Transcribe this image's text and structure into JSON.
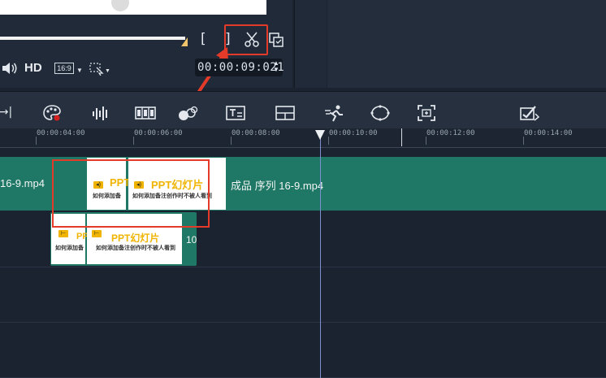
{
  "preview": {
    "hd_label": "HD",
    "aspect_ratio": "16:9",
    "timecode": "00:00:09:021",
    "mark_in": "[",
    "mark_out": "]"
  },
  "toolbar": {
    "icons": [
      "insert-arrow-icon",
      "color-palette-icon",
      "audio-wave-icon",
      "storyboard-icon",
      "motion-path-icon",
      "title-icon",
      "split-screen-icon",
      "motion-tracking-icon",
      "mask-icon",
      "crop-capture-icon",
      "auto-edit-icon"
    ]
  },
  "ruler": {
    "labels": [
      "00:00:04:00",
      "00:00:06:00",
      "00:00:08:00",
      "00:00:10:00",
      "00:00:12:00",
      "00:00:14:00"
    ]
  },
  "timeline": {
    "main_clip_left": "16-9.mp4",
    "main_clip_right": "成品 序列 16-9.mp4",
    "thumb_title": "PPT幻灯片",
    "thumb_title_short": "PPT",
    "thumb_title_cut": "PP",
    "thumb_sub": "如何添加备注创作时不被人看到",
    "thumb_sub_short": "如何添加备",
    "overlay_label": "10"
  },
  "colors": {
    "clip_green": "#1f7866",
    "highlight_red": "#e33a2a",
    "thumb_yellow": "#f0b400",
    "background": "#1b2330"
  }
}
